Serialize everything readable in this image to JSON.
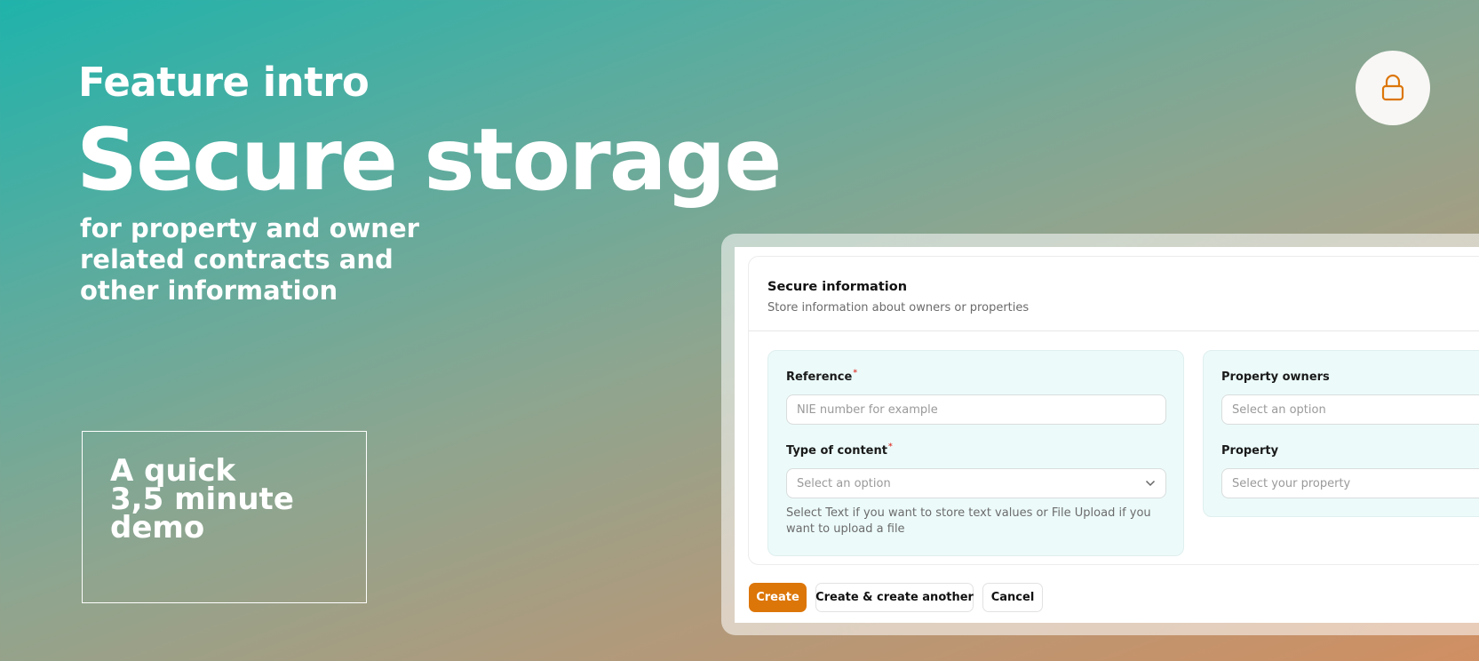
{
  "hero": {
    "eyebrow": "Feature intro",
    "title": "Secure storage",
    "subtitle": "for property and owner related contracts and other information"
  },
  "demo_box": {
    "lines": [
      "A quick",
      "3,5 minute",
      "demo"
    ]
  },
  "badge": {
    "icon": "lock-icon",
    "accent": "#dc7609"
  },
  "form": {
    "title": "Secure information",
    "description": "Store information about owners or properties",
    "left_section": {
      "reference": {
        "label": "Reference",
        "required": "*",
        "placeholder": "NIE number for example",
        "value": ""
      },
      "type_of_content": {
        "label": "Type of content",
        "required": "*",
        "placeholder": "Select an option",
        "value": "",
        "icon": "chevron-down-icon",
        "help": "Select Text if you want to store text values or File Upload if you want to upload a file"
      }
    },
    "right_section": {
      "property_owners": {
        "label": "Property owners",
        "placeholder": "Select an option",
        "value": ""
      },
      "property": {
        "label": "Property",
        "placeholder": "Select your property",
        "value": ""
      }
    },
    "actions": {
      "create": "Create",
      "create_another": "Create & create another",
      "cancel": "Cancel"
    }
  },
  "colors": {
    "primary": "#dc7609",
    "section_bg": "#ecfbfa",
    "required": "#e0413a"
  }
}
